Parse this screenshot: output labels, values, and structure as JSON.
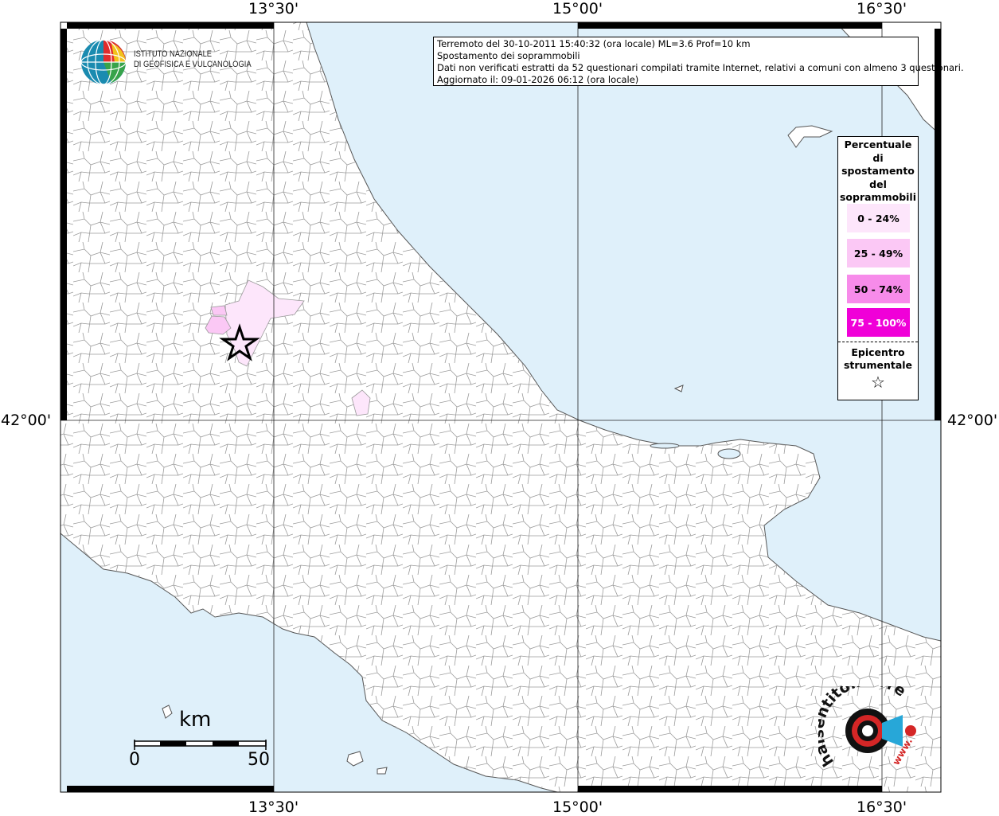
{
  "map": {
    "title_lines": [
      "Terremoto del 30-10-2011 15:40:32 (ora locale) ML=3.6 Prof=10 km",
      "Spostamento dei soprammobili",
      "Dati non verificati estratti da 52 questionari compilati tramite Internet, relativi a comuni con almeno 3 questionari.",
      "Aggiornato il: 09-01-2026 06:12 (ora locale)"
    ],
    "top_axis_labels": [
      "13°30'",
      "15°00'",
      "16°30'"
    ],
    "bottom_axis_labels": [
      "13°30'",
      "15°00'",
      "16°30'"
    ],
    "left_axis_label": "42°00'",
    "right_axis_label": "42°00'",
    "colors": {
      "sea": "#dff0fa",
      "land": "#ffffff",
      "border": "#8a8a8a",
      "class_0_24": "#fde6fb",
      "class_25_49": "#fbc8f5",
      "class_50_74": "#f78bea",
      "class_75_100": "#f000d8"
    }
  },
  "logo": {
    "line1": "ISTITUTO NAZIONALE",
    "line2": "DI GEOFISICA E VULCANOLOGIA",
    "icon": "ingv-globe-icon"
  },
  "legend": {
    "title_lines": [
      "Percentuale",
      "di",
      "spostamento",
      "del",
      "soprammobili"
    ],
    "classes": [
      "0 - 24%",
      "25 - 49%",
      "50 - 74%",
      "75 - 100%"
    ],
    "epicenter_lines": [
      "Epicentro",
      "strumentale"
    ],
    "epicenter_symbol": "☆"
  },
  "scalebar": {
    "label": "km",
    "start": "0",
    "end": "50"
  },
  "watermark": {
    "text": "haisentitoilterremoto.it",
    "url_text": "www."
  }
}
